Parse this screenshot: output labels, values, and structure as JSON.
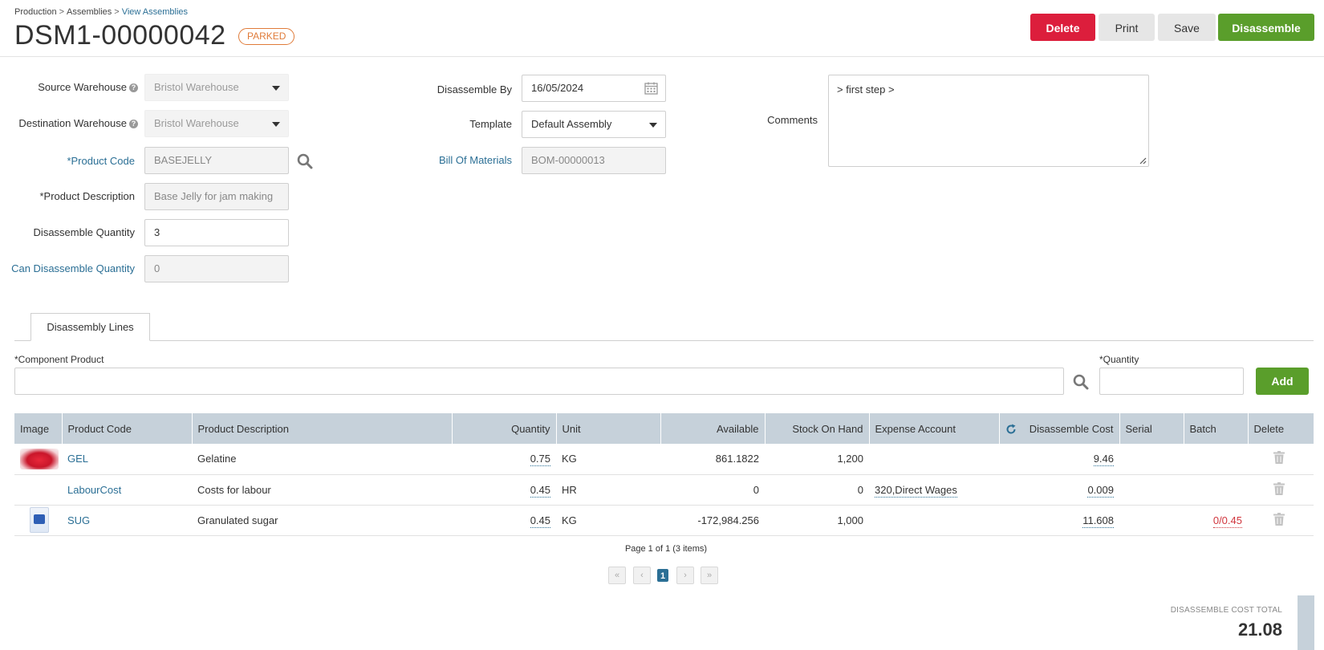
{
  "breadcrumb": {
    "items": [
      "Production",
      "Assemblies"
    ],
    "current": "View Assemblies",
    "sep": ">"
  },
  "page": {
    "title": "DSM1-00000042",
    "status": "PARKED"
  },
  "actions": {
    "delete": "Delete",
    "print": "Print",
    "save": "Save",
    "disassemble": "Disassemble"
  },
  "form": {
    "source_warehouse": {
      "label": "Source Warehouse",
      "value": "Bristol Warehouse"
    },
    "destination_warehouse": {
      "label": "Destination Warehouse",
      "value": "Bristol Warehouse"
    },
    "product_code": {
      "label": "*Product Code",
      "value": "BASEJELLY"
    },
    "product_description": {
      "label": "*Product Description",
      "value": "Base Jelly for jam making"
    },
    "disassemble_quantity": {
      "label": "Disassemble Quantity",
      "value": "3"
    },
    "can_disassemble_quantity": {
      "label": "Can Disassemble Quantity",
      "value": "0"
    },
    "disassemble_by": {
      "label": "Disassemble By",
      "value": "16/05/2024"
    },
    "template": {
      "label": "Template",
      "value": "Default Assembly"
    },
    "bill_of_materials": {
      "label": "Bill Of Materials",
      "value": "BOM-00000013"
    },
    "comments": {
      "label": "Comments",
      "value": "> first step >"
    }
  },
  "tabs": [
    {
      "label": "Disassembly Lines"
    }
  ],
  "add_line": {
    "component_label": "*Component Product",
    "quantity_label": "*Quantity",
    "add": "Add"
  },
  "table": {
    "headers": {
      "image": "Image",
      "product_code": "Product Code",
      "product_description": "Product Description",
      "quantity": "Quantity",
      "unit": "Unit",
      "available": "Available",
      "stock_on_hand": "Stock On Hand",
      "expense_account": "Expense Account",
      "disassemble_cost": "Disassemble Cost",
      "serial": "Serial",
      "batch": "Batch",
      "delete": "Delete"
    },
    "rows": [
      {
        "code": "GEL",
        "description": "Gelatine",
        "quantity": "0.75",
        "unit": "KG",
        "available": "861.1822",
        "stock_on_hand": "1,200",
        "expense_account": "",
        "cost": "9.46",
        "serial": "",
        "batch": "",
        "image": "jelly-thumbnail"
      },
      {
        "code": "LabourCost",
        "description": "Costs for labour",
        "quantity": "0.45",
        "unit": "HR",
        "available": "0",
        "stock_on_hand": "0",
        "expense_account": "320,Direct Wages",
        "cost": "0.009",
        "serial": "",
        "batch": "",
        "image": ""
      },
      {
        "code": "SUG",
        "description": "Granulated sugar",
        "quantity": "0.45",
        "unit": "KG",
        "available": "-172,984.256",
        "stock_on_hand": "1,000",
        "expense_account": "",
        "cost": "11.608",
        "serial": "",
        "batch": "0/0.45",
        "image": "sugar-bag-thumbnail"
      }
    ]
  },
  "pagination": {
    "summary": "Page 1 of 1 (3 items)",
    "current": "1"
  },
  "totals": {
    "label": "DISASSEMBLE COST TOTAL",
    "value": "21.08"
  },
  "colors": {
    "delete": "#dc1e3c",
    "primary": "#5a9e2b",
    "link": "#2b6f95",
    "status": "#e07b39",
    "table_header": "#c6d1da"
  }
}
